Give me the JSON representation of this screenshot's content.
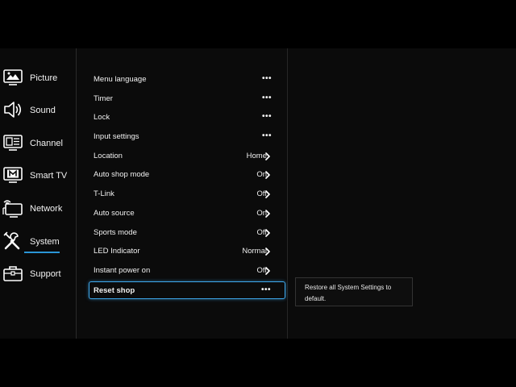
{
  "sidebar": {
    "items": [
      {
        "label": "Picture",
        "icon": "picture-icon"
      },
      {
        "label": "Sound",
        "icon": "sound-icon"
      },
      {
        "label": "Channel",
        "icon": "channel-icon"
      },
      {
        "label": "Smart TV",
        "icon": "smart-tv-icon"
      },
      {
        "label": "Network",
        "icon": "network-icon"
      },
      {
        "label": "System",
        "icon": "system-icon",
        "active": true
      },
      {
        "label": "Support",
        "icon": "support-icon"
      }
    ]
  },
  "menu": {
    "items": [
      {
        "label": "Menu language",
        "value": "",
        "control": "more"
      },
      {
        "label": "Timer",
        "value": "",
        "control": "more"
      },
      {
        "label": "Lock",
        "value": "",
        "control": "more"
      },
      {
        "label": "Input settings",
        "value": "",
        "control": "more"
      },
      {
        "label": "Location",
        "value": "Home",
        "control": "chevron"
      },
      {
        "label": "Auto shop mode",
        "value": "On",
        "control": "chevron"
      },
      {
        "label": "T-Link",
        "value": "Off",
        "control": "chevron"
      },
      {
        "label": "Auto source",
        "value": "On",
        "control": "chevron"
      },
      {
        "label": "Sports mode",
        "value": "Off",
        "control": "chevron"
      },
      {
        "label": "LED Indicator",
        "value": "Normal",
        "control": "chevron"
      },
      {
        "label": "Instant power on",
        "value": "Off",
        "control": "chevron"
      },
      {
        "label": "Reset shop",
        "value": "",
        "control": "more",
        "selected": true
      }
    ],
    "more_glyph": "•••"
  },
  "tooltip": {
    "text": "Restore all System Settings to default."
  },
  "colors": {
    "accent": "#3ea8ec",
    "background": "#000000",
    "panel": "#0b0b0b"
  }
}
